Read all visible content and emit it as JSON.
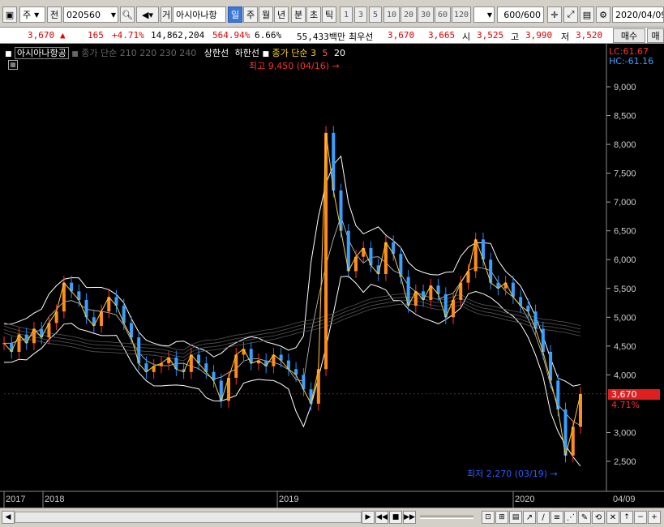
{
  "toolbar": {
    "market": "주",
    "prev": "전",
    "code": "020560",
    "name_label": "거",
    "stock_name": "아시아나항",
    "periods": [
      "일",
      "주",
      "월",
      "년",
      "분",
      "초",
      "틱"
    ],
    "active_period": "일",
    "intervals": [
      "1",
      "3",
      "5",
      "10",
      "20",
      "30",
      "60",
      "120"
    ],
    "count": "600",
    "count_total": "/600",
    "date": "2020/04/09"
  },
  "quote": {
    "price": "3,670",
    "change": "165",
    "change_pct": "+4.71%",
    "volume": "14,862,204",
    "vol_ratio": "564.94%",
    "turnover": "6.66%",
    "amount": "55,433백만",
    "best_ask_label": "최우선",
    "best_ask": "3,670",
    "best_bid": "3,665",
    "open_label": "시",
    "open": "3,525",
    "high_label": "고",
    "high": "3,990",
    "low_label": "저",
    "low": "3,520",
    "buy_label": "매수",
    "sell_label": "매"
  },
  "chart": {
    "stock_label": "아시아나항공",
    "legend_ma": "종가 단순 210 220 230 240",
    "legend_upper": "상한선",
    "legend_lower": "하한선",
    "legend_vol_ma": "종가 단순 3",
    "legend_vol_5": "5",
    "legend_vol_20": "20",
    "lc": "LC:61.67",
    "hc": "HC:-61.16",
    "max_label": "최고 9,450 (04/16)",
    "min_label": "최저 2,270 (03/19)",
    "current_price": "3,670",
    "current_pct": "4.71%",
    "y_ticks": [
      "9,000",
      "8,500",
      "8,000",
      "7,500",
      "7,000",
      "6,500",
      "6,000",
      "5,500",
      "5,000",
      "4,500",
      "4,000",
      "3,000",
      "2,500"
    ],
    "x_labels": [
      "2017",
      "2018",
      "2019",
      "2020"
    ],
    "x_last": "04/09",
    "colors": {
      "up": "#ff3030",
      "down": "#2090ff",
      "ma": "#ffffff",
      "accent": "#ff0000"
    }
  },
  "chart_data": {
    "type": "line",
    "title": "",
    "series_price": [
      4550,
      4400,
      4700,
      4550,
      4800,
      4650,
      4900,
      5100,
      5600,
      5450,
      5300,
      5000,
      4850,
      5100,
      5350,
      5200,
      4900,
      4650,
      4200,
      4050,
      4150,
      4200,
      4300,
      4100,
      4050,
      4350,
      4200,
      4050,
      3900,
      3550,
      3950,
      4350,
      4450,
      4200,
      4250,
      4150,
      4350,
      4250,
      4100,
      4000,
      3750,
      3500,
      4100,
      8200,
      7200,
      6500,
      5800,
      6050,
      6200,
      5900,
      5750,
      6300,
      6100,
      5700,
      5200,
      5450,
      5300,
      5550,
      5400,
      5000,
      5300,
      5600,
      5800,
      6350,
      6000,
      5600,
      5500,
      5600,
      5350,
      5200,
      5100,
      4800,
      4400,
      3900,
      3400,
      2600,
      3100,
      3670
    ],
    "y_range": [
      2270,
      9450
    ],
    "x_years": [
      "2017",
      "2018",
      "2019",
      "2020"
    ]
  }
}
